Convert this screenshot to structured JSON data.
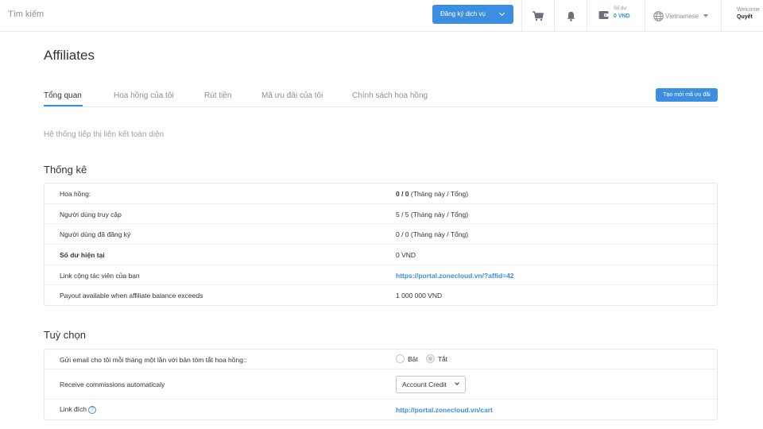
{
  "topbar": {
    "search_placeholder": "Tìm kiếm",
    "register_label": "Đăng ký dịch vụ",
    "balance_label": "Số dư",
    "balance_value": "0 VND",
    "language": "Vietnamese",
    "welcome_label": "Welcome",
    "user_name": "Quyết"
  },
  "page": {
    "title": "Affiliates",
    "tabs": [
      {
        "label": "Tổng quan"
      },
      {
        "label": "Hoa hồng của tôi"
      },
      {
        "label": "Rút tiền"
      },
      {
        "label": "Mã ưu đãi của tôi"
      },
      {
        "label": "Chính sách hoa hồng"
      }
    ],
    "new_code_button": "Tạo mới mã ưu đãi",
    "intro": "Hệ thống tiếp thị liên kết toàn diện"
  },
  "stats": {
    "title": "Thống kê",
    "rows": [
      {
        "label": "Hoa hồng:",
        "value_bold": "0 / 0",
        "value_suffix": " (Tháng này / Tổng)"
      },
      {
        "label": "Người dùng truy cập",
        "value": "5 / 5 (Tháng này / Tổng)"
      },
      {
        "label": "Người dùng đã đăng ký",
        "value": "0 / 0 (Tháng này / Tổng)"
      },
      {
        "label": "Số dư hiện tại",
        "value": "0 VND"
      },
      {
        "label": "Link cộng tác viên của bạn",
        "value": "https://portal.zonecloud.vn/?affid=42"
      },
      {
        "label": "Payout available when affiliate balance exceeds",
        "value": "1 000 000 VND"
      }
    ]
  },
  "options": {
    "title": "Tuỳ chọn",
    "email_label": "Gửi email cho tôi mỗi tháng một lần với bản tóm tắt hoa hồng::",
    "radio_on": "Bật",
    "radio_off": "Tắt",
    "radio_selected": "Tắt",
    "commission_label": "Receive commissions automaticaly",
    "commission_select_value": "Account Credit",
    "link_label": "Link đích",
    "link_value": "http://portal.zonecloud.vn/cart"
  },
  "colors": {
    "accent": "#3c8ee0",
    "muted_text": "#8a8f98",
    "border": "#e6e8eb"
  }
}
